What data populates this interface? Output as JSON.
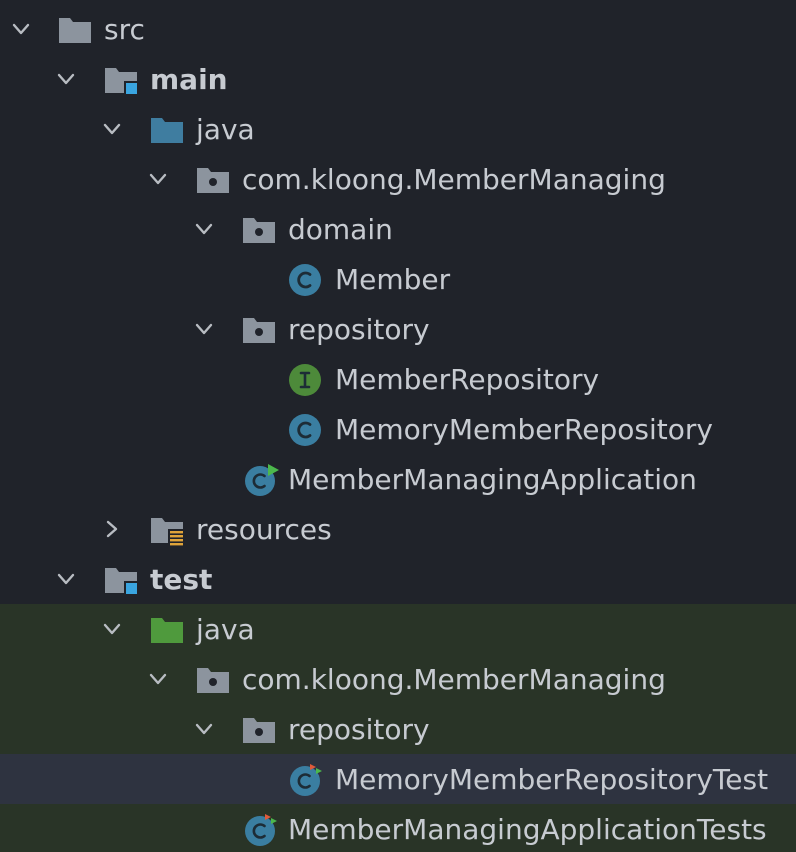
{
  "tree": {
    "src": "src",
    "main": "main",
    "main_java": "java",
    "main_pkg": "com.kloong.MemberManaging",
    "domain": "domain",
    "member": "Member",
    "repository": "repository",
    "member_repository": "MemberRepository",
    "memory_member_repository": "MemoryMemberRepository",
    "app": "MemberManagingApplication",
    "resources": "resources",
    "test": "test",
    "test_java": "java",
    "test_pkg": "com.kloong.MemberManaging",
    "test_repository": "repository",
    "memory_repo_test": "MemoryMemberRepositoryTest",
    "app_tests": "MemberManagingApplicationTests"
  },
  "icons": {
    "folder": "folder-icon",
    "module_folder": "module-folder-icon",
    "source_root": "source-root-icon",
    "test_root": "test-source-root-icon",
    "package": "package-icon",
    "class": "class-icon",
    "interface": "interface-icon",
    "spring_app": "spring-application-class-icon",
    "test_class": "test-class-icon",
    "resources": "resources-folder-icon",
    "expanded": "chevron-down-icon",
    "collapsed": "chevron-right-icon"
  },
  "colors": {
    "background": "#20232a",
    "text": "#c7cbd1",
    "folder": "#8c949e",
    "source_root": "#3f7da0",
    "test_root": "#4f9a3d",
    "class_icon": "#3a7ea1",
    "interface_icon": "#4d8a3a",
    "module_badge": "#3aa5e0",
    "test_area": "#293427",
    "selected_row": "#2e3340"
  }
}
